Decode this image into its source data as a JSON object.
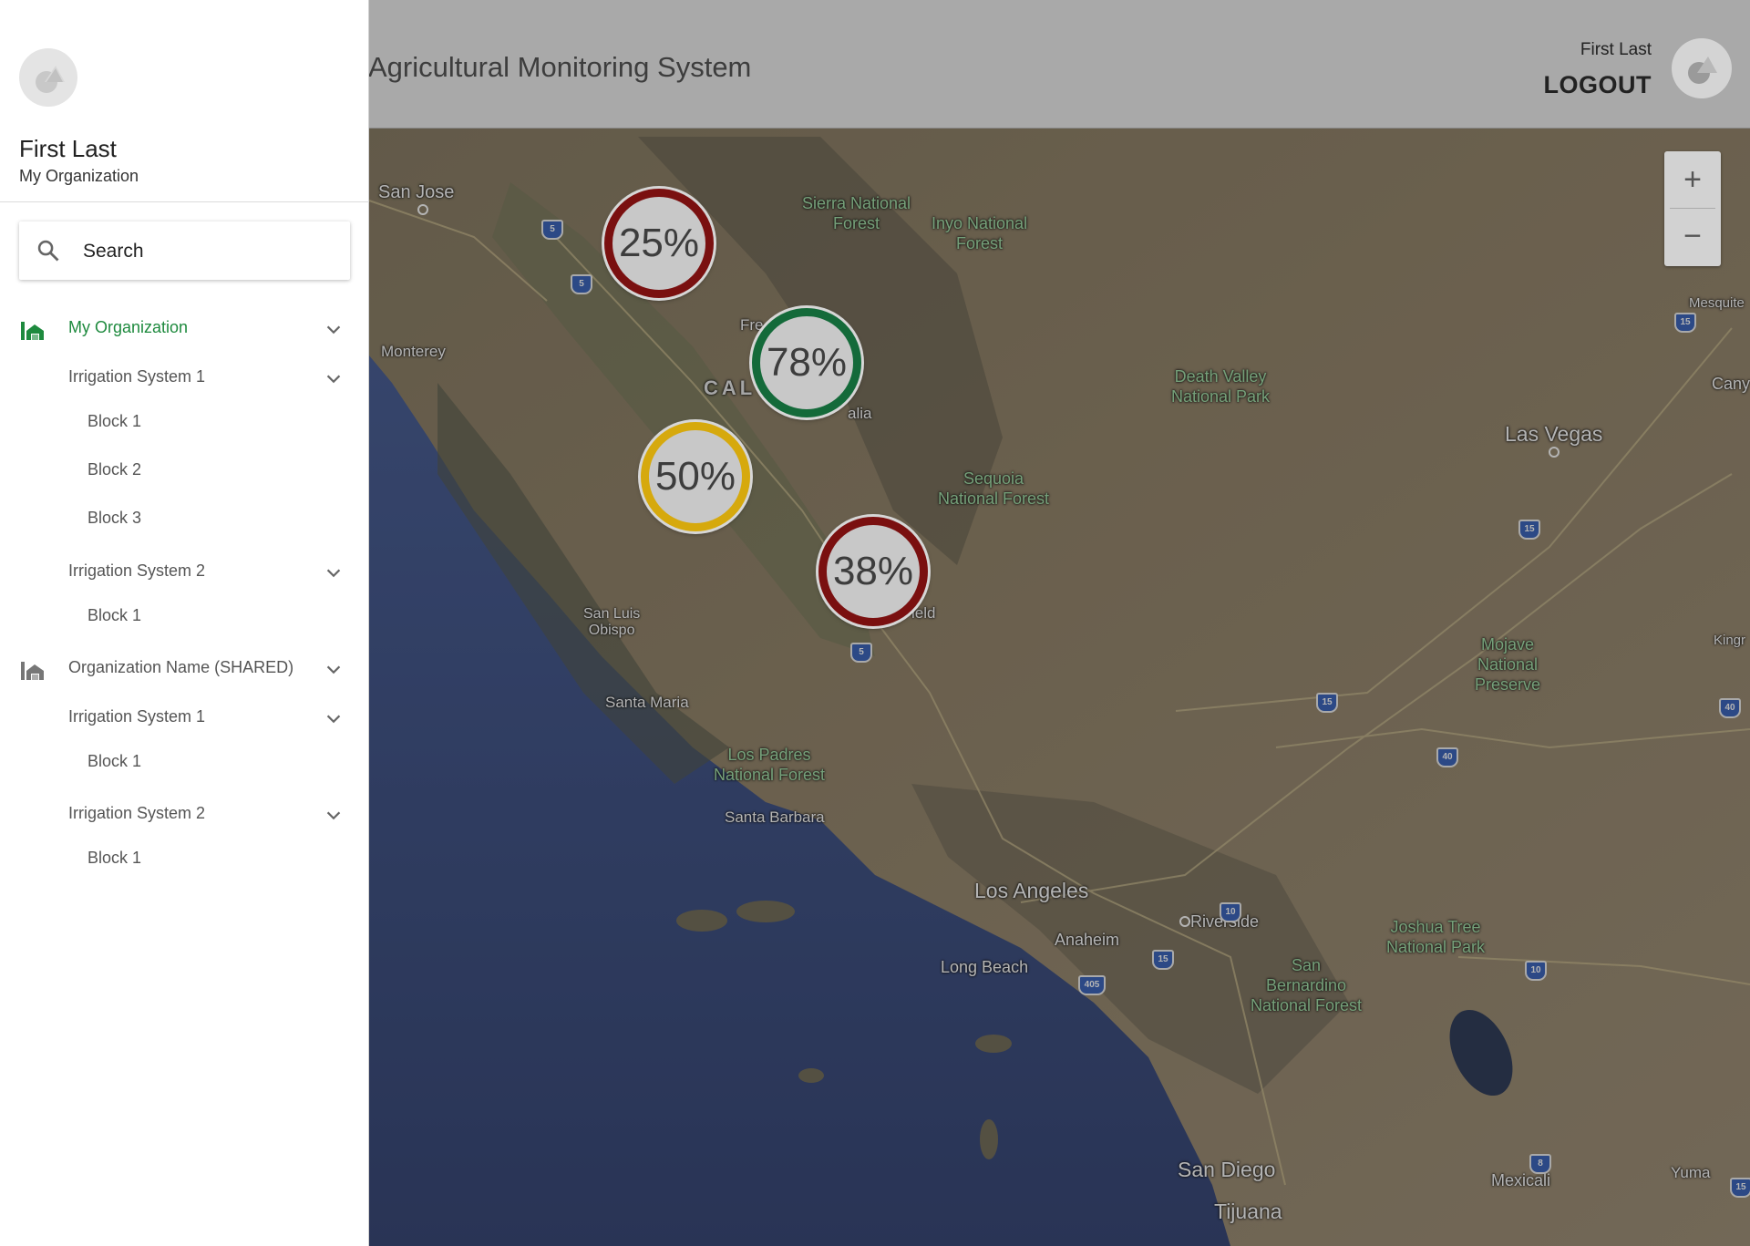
{
  "header": {
    "app_title": "Agricultural Monitoring System",
    "user_name": "First Last",
    "logout_label": "LOGOUT"
  },
  "sidebar": {
    "profile_name": "First Last",
    "profile_org": "My Organization",
    "search_placeholder": "Search",
    "tree": [
      {
        "label": "My Organization",
        "level": 0,
        "active": true
      },
      {
        "label": "Irrigation System 1",
        "level": 1
      },
      {
        "label": "Block 1",
        "level": 2
      },
      {
        "label": "Block 2",
        "level": 2
      },
      {
        "label": "Block 3",
        "level": 2
      },
      {
        "label": "Irrigation System 2",
        "level": 1
      },
      {
        "label": "Block 1",
        "level": 2
      },
      {
        "label": "Organization Name (SHARED)",
        "level": 0
      },
      {
        "label": "Irrigation System 1",
        "level": 1
      },
      {
        "label": "Block 1",
        "level": 2
      },
      {
        "label": "Irrigation System 2",
        "level": 1
      },
      {
        "label": "Block 1",
        "level": 2
      }
    ]
  },
  "map": {
    "zoom_in": "+",
    "zoom_out": "−",
    "markers": [
      {
        "value": "25%",
        "status_color": "#7a1010"
      },
      {
        "value": "78%",
        "status_color": "#146a3a"
      },
      {
        "value": "50%",
        "status_color": "#d6a90d"
      },
      {
        "value": "38%",
        "status_color": "#7a1010"
      }
    ],
    "places": {
      "san_jose": "San Jose",
      "monterey": "Monterey",
      "fresno_partial": "Fre",
      "state_partial": "CAL",
      "visalia_partial": "alia",
      "bakersfield_partial": "ield",
      "san_luis_obispo": "San Luis\nObispo",
      "santa_maria": "Santa Maria",
      "santa_barbara": "Santa Barbara",
      "los_angeles": "Los Angeles",
      "anaheim": "Anaheim",
      "long_beach": "Long Beach",
      "riverside": "Riverside",
      "san_diego": "San Diego",
      "tijuana": "Tijuana",
      "mexicali": "Mexicali",
      "yuma": "Yuma",
      "las_vegas": "Las Vegas",
      "mesquite_partial": "Mesquite",
      "kingman_partial": "Kingr",
      "canyon_partial": "Cany",
      "sierra_nf": "Sierra National\nForest",
      "inyo_nf": "Inyo National\nForest",
      "death_valley": "Death Valley\nNational Park",
      "sequoia_nf": "Sequoia\nNational Forest",
      "mojave": "Mojave\nNational\nPreserve",
      "los_padres": "Los Padres\nNational Forest",
      "joshua_tree": "Joshua Tree\nNational Park",
      "san_bernardino": "San\nBernardino\nNational Forest"
    },
    "shields": [
      "5",
      "5",
      "5",
      "15",
      "15",
      "15",
      "40",
      "40",
      "10",
      "10",
      "10",
      "15",
      "405",
      "8",
      "15"
    ]
  }
}
